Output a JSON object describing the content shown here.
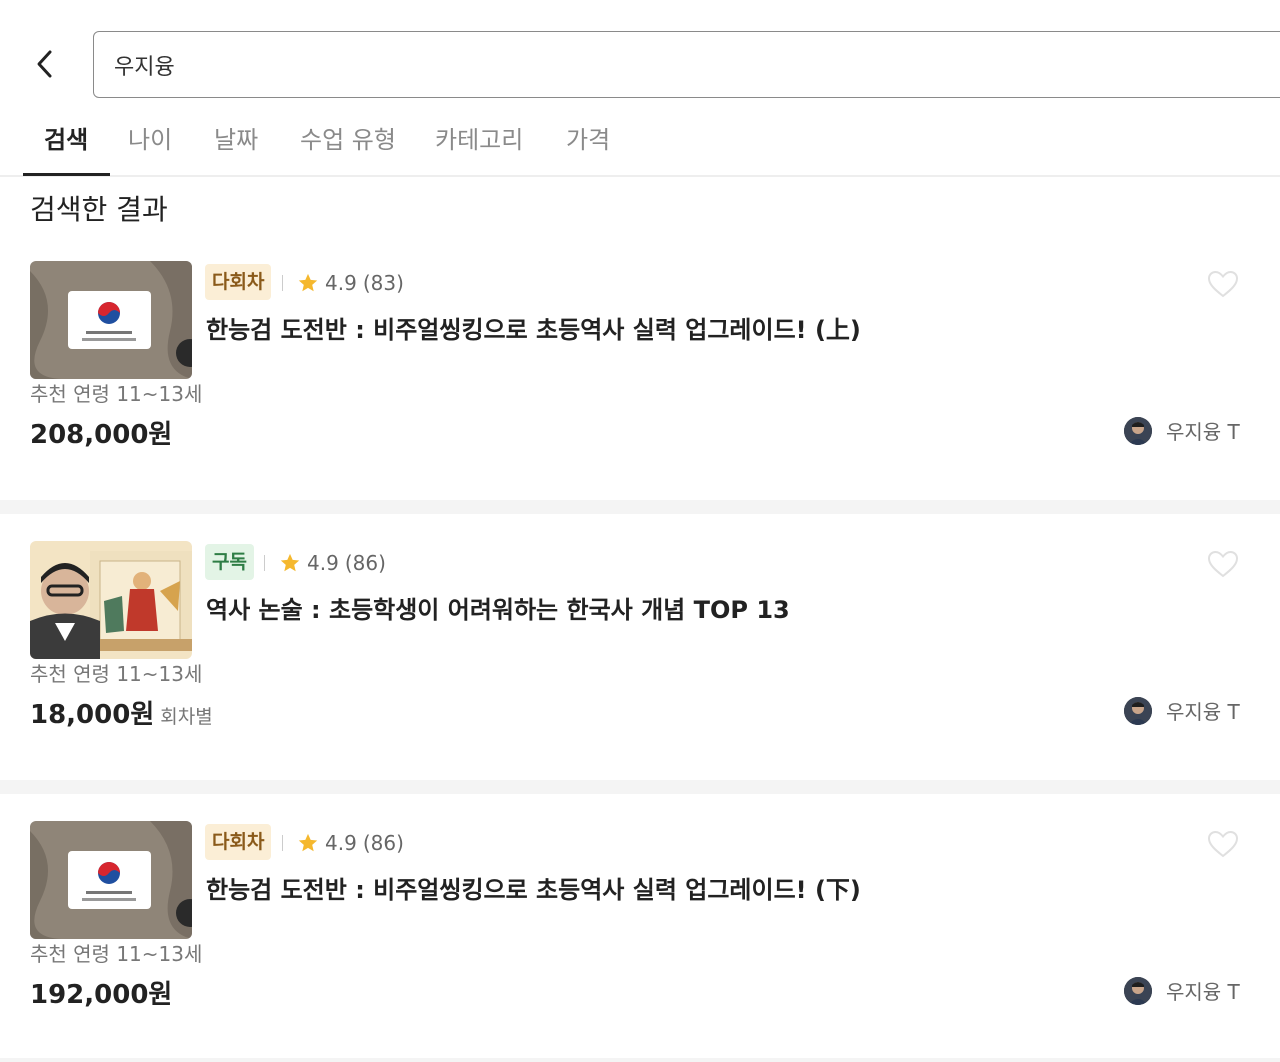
{
  "search": {
    "value": "우지융"
  },
  "tabs": [
    {
      "label": "검색"
    },
    {
      "label": "나이"
    },
    {
      "label": "날짜"
    },
    {
      "label": "수업 유형"
    },
    {
      "label": "카테고리"
    },
    {
      "label": "가격"
    }
  ],
  "results": {
    "heading": "검색한 결과",
    "items": [
      {
        "badge": "다회차",
        "rating": "4.9",
        "reviews": "(83)",
        "title": "한능검 도전반 : 비주얼씽킹으로 초등역사 실력 업그레이드! (上)",
        "age": "추천 연령 11~13세",
        "price": "208,000원",
        "price_note": "",
        "teacher": "우지융 T"
      },
      {
        "badge": "구독",
        "rating": "4.9",
        "reviews": "(86)",
        "title": "역사 논술 : 초등학생이 어려워하는 한국사 개념 TOP 13",
        "age": "추천 연령 11~13세",
        "price": "18,000원",
        "price_note": "회차별",
        "teacher": "우지융 T"
      },
      {
        "badge": "다회차",
        "rating": "4.9",
        "reviews": "(86)",
        "title": "한능검 도전반 : 비주얼씽킹으로 초등역사 실력 업그레이드! (下)",
        "age": "추천 연령 11~13세",
        "price": "192,000원",
        "price_note": "",
        "teacher": "우지융 T"
      }
    ]
  },
  "colors": {
    "badge_multi_bg": "#fbeed6",
    "badge_sub_bg": "#e3f4e6",
    "star": "#f5b82e"
  },
  "icons": [
    "chevron-left-icon",
    "star-icon",
    "heart-icon",
    "avatar"
  ]
}
